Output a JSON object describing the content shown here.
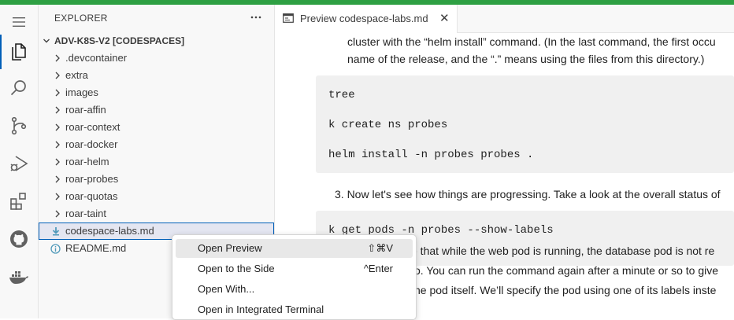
{
  "colors": {
    "accent": "#005fb8",
    "top_strip": "#2ea043",
    "selection": "#e4e6f1"
  },
  "activity_bar": {
    "items": [
      {
        "name": "menu-icon"
      },
      {
        "name": "explorer-icon"
      },
      {
        "name": "search-icon"
      },
      {
        "name": "source-control-icon"
      },
      {
        "name": "run-debug-icon"
      },
      {
        "name": "extensions-icon"
      },
      {
        "name": "github-icon"
      },
      {
        "name": "docker-icon"
      }
    ]
  },
  "explorer": {
    "title": "EXPLORER",
    "section": "ADV-K8S-V2 [CODESPACES]",
    "folders": [
      ".devcontainer",
      "extra",
      "images",
      "roar-affin",
      "roar-context",
      "roar-docker",
      "roar-helm",
      "roar-probes",
      "roar-quotas",
      "roar-taint"
    ],
    "files": [
      {
        "label": "codespace-labs.md",
        "icon": "markdown-download-icon",
        "selected": true
      },
      {
        "label": "README.md",
        "icon": "info-icon",
        "selected": false
      }
    ]
  },
  "tab": {
    "label": "Preview codespace-labs.md",
    "close": "✕"
  },
  "preview": {
    "line1": "cluster with the “helm install” command. (In the last command, the first occu",
    "line2": "name of the release, and the “.” means using the files from this directory.)",
    "code1": [
      "tree",
      "k create ns probes",
      "helm install -n probes probes ."
    ],
    "step3": "3. Now let's see how things are progressing. Take a look at the overall status of",
    "code2": "k get pods -n probes --show-labels",
    "line3": "e that while the web pod is running, the database pod is not re",
    "line4": "o. You can run the command again after a minute or so to give",
    "line5": "he pod itself. We’ll specify the pod using one of its labels inste"
  },
  "context_menu": {
    "items": [
      {
        "label": "Open Preview",
        "shortcut": "⇧⌘V",
        "highlighted": true
      },
      {
        "label": "Open to the Side",
        "shortcut": "^Enter",
        "highlighted": false
      },
      {
        "label": "Open With...",
        "shortcut": "",
        "highlighted": false
      },
      {
        "label": "Open in Integrated Terminal",
        "shortcut": "",
        "highlighted": false
      }
    ]
  }
}
